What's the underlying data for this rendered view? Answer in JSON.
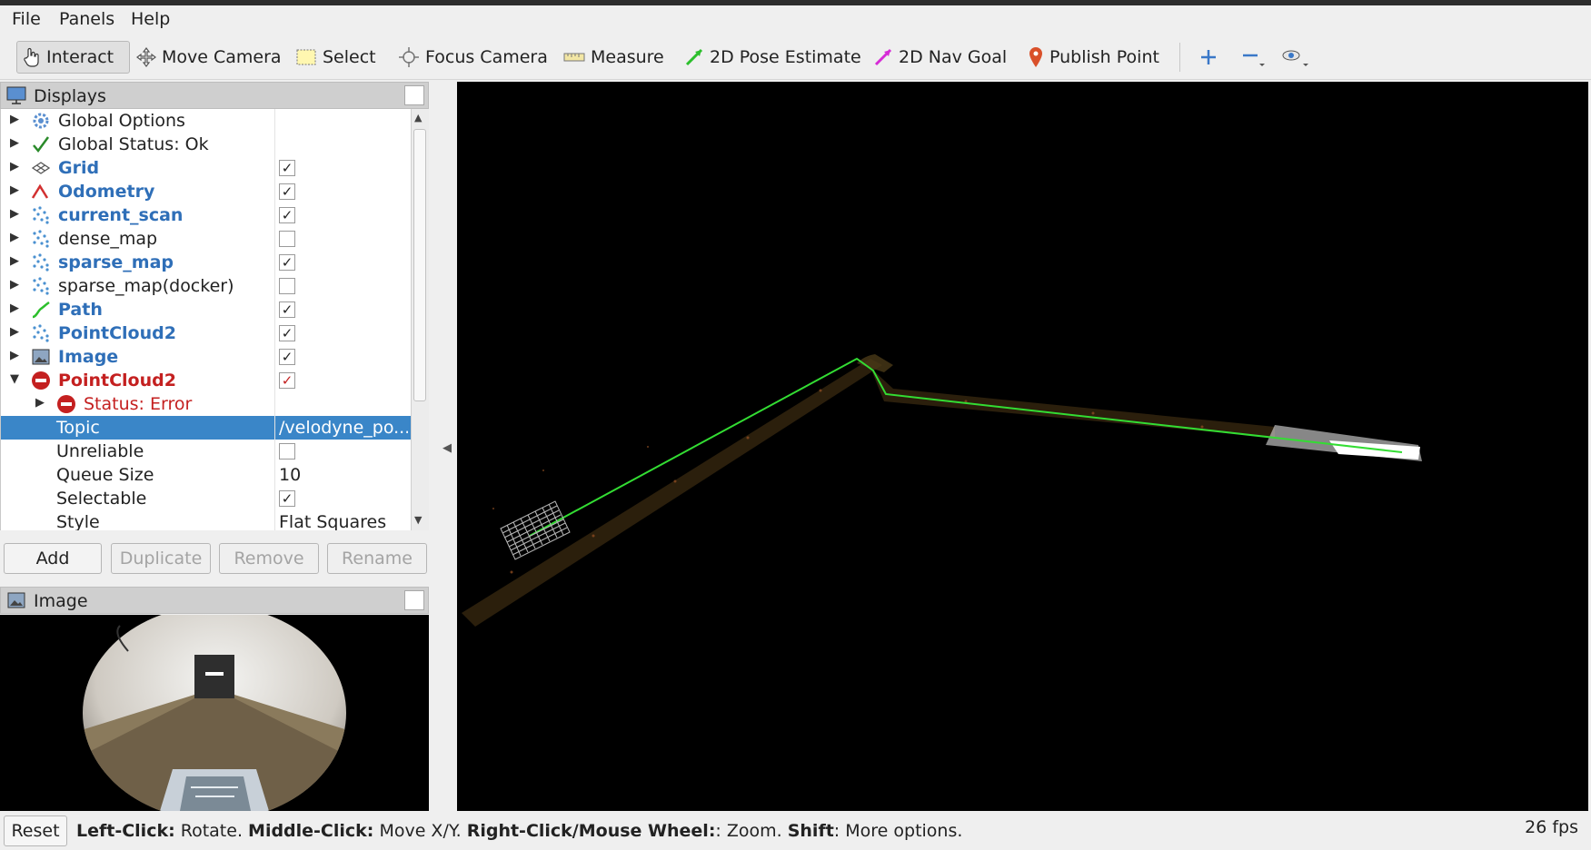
{
  "menu": {
    "file": "File",
    "panels": "Panels",
    "help": "Help"
  },
  "toolbar": {
    "interact": "Interact",
    "move_camera": "Move Camera",
    "select": "Select",
    "focus_camera": "Focus Camera",
    "measure": "Measure",
    "pose_estimate": "2D Pose Estimate",
    "nav_goal": "2D Nav Goal",
    "publish_point": "Publish Point"
  },
  "displays": {
    "title": "Displays",
    "rows": [
      {
        "label": "Global Options"
      },
      {
        "label": "Global Status: Ok"
      },
      {
        "label": "Grid",
        "checked": true
      },
      {
        "label": "Odometry",
        "checked": true
      },
      {
        "label": "current_scan",
        "checked": true
      },
      {
        "label": "dense_map",
        "checked": false
      },
      {
        "label": "sparse_map",
        "checked": true
      },
      {
        "label": "sparse_map(docker)",
        "checked": false
      },
      {
        "label": "Path",
        "checked": true
      },
      {
        "label": "PointCloud2",
        "checked": true
      },
      {
        "label": "Image",
        "checked": true
      },
      {
        "label": "PointCloud2",
        "checked": true
      },
      {
        "label": "Status: Error"
      },
      {
        "label": "Topic",
        "value": "/velodyne_po..."
      },
      {
        "label": "Unreliable",
        "checked": false
      },
      {
        "label": "Queue Size",
        "value": "10"
      },
      {
        "label": "Selectable",
        "checked": true
      },
      {
        "label": "Style",
        "value": "Flat Squares"
      }
    ],
    "buttons": {
      "add": "Add",
      "duplicate": "Duplicate",
      "remove": "Remove",
      "rename": "Rename"
    }
  },
  "image_panel": {
    "title": "Image"
  },
  "status": {
    "reset": "Reset",
    "h1b": "Left-Click:",
    "h1": " Rotate. ",
    "h2b": "Middle-Click:",
    "h2": " Move X/Y. ",
    "h3b": "Right-Click/Mouse Wheel:",
    "h3": ": Zoom. ",
    "h4b": "Shift",
    "h4": ": More options.",
    "fps": "26 fps"
  },
  "colors": {
    "selection": "#3a86c8",
    "display_enabled": "#2f6fb8",
    "error": "#c42020",
    "path": "#33dd33"
  }
}
